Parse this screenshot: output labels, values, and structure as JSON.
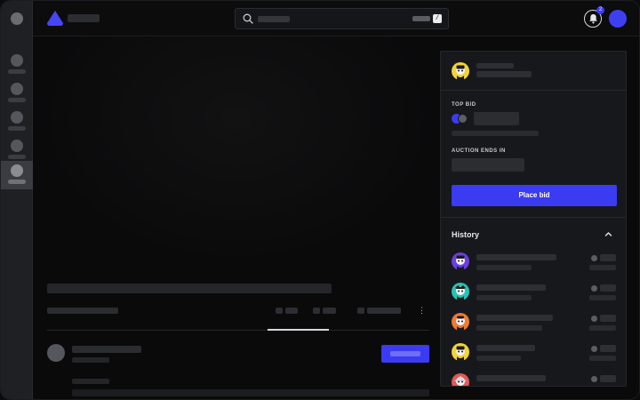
{
  "colors": {
    "accent": "#3b3bf2",
    "background": "#0a0a0b",
    "panel": "#17181b"
  },
  "topbar": {
    "search": {
      "shortcut_key": "/"
    },
    "notifications": {
      "count": "2"
    }
  },
  "sidebar": {
    "items": [
      {
        "icon": "nav-icon",
        "active": false
      },
      {
        "icon": "nav-icon",
        "active": false
      },
      {
        "icon": "nav-icon",
        "active": false
      },
      {
        "icon": "nav-icon",
        "active": false
      },
      {
        "icon": "nav-icon",
        "active": true
      }
    ]
  },
  "panel": {
    "top_bid_label": "TOP BID",
    "auction_label": "AUCTION ENDS IN",
    "place_bid_label": "Place bid",
    "history_title": "History",
    "history": [
      {
        "avatar_color": "#6b3fe0"
      },
      {
        "avatar_color": "#27c2b8"
      },
      {
        "avatar_color": "#f07a2f"
      },
      {
        "avatar_color": "#f2d33a"
      },
      {
        "avatar_color": "#e05a5a"
      }
    ]
  }
}
